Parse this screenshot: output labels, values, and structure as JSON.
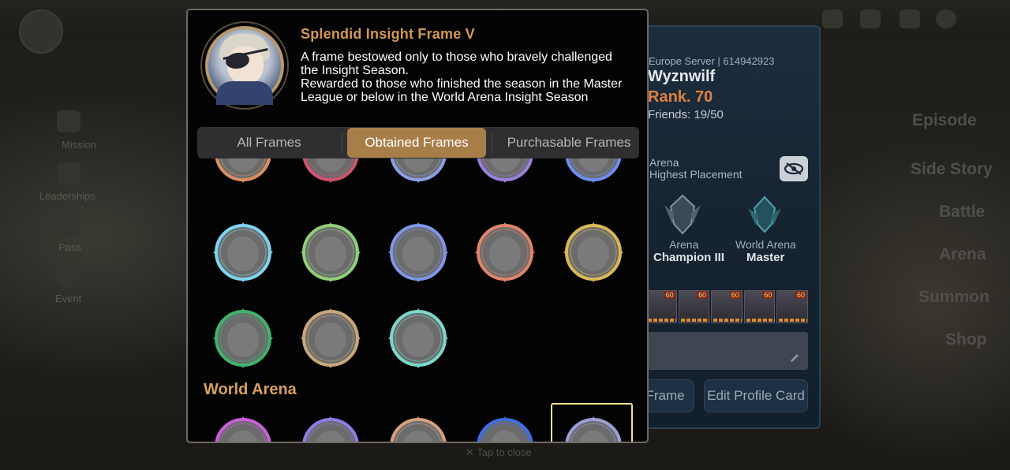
{
  "background": {
    "left_menu": [
      "Mission",
      "Leaderships",
      "Pass",
      "Event"
    ],
    "right_menu": [
      "Episode",
      "Side Story",
      "Battle",
      "Arena",
      "Summon",
      "Shop"
    ],
    "tap_to_close": "Tap to close"
  },
  "profile_card": {
    "server": "Europe Server | 614942923",
    "name": "Wyznwilf",
    "rank": "Rank. 70",
    "friends": "Friends: 19/50",
    "arena_highest_label_1": "Arena",
    "arena_highest_label_2": "Highest Placement",
    "arena": {
      "label": "Arena",
      "value": "Champion III"
    },
    "world_arena": {
      "label": "World Arena",
      "value": "Master"
    },
    "hero_levels": [
      "60",
      "60",
      "60",
      "60",
      "60"
    ],
    "frame_button": "Frame",
    "edit_profile_button": "Edit Profile Card",
    "colors": {
      "rank": "#e0813a"
    }
  },
  "dialog": {
    "frame_title": "Splendid Insight Frame V",
    "description_lines": [
      "A frame bestowed only to those who bravely challenged",
      "the Insight Season.",
      "Rewarded to those who finished the season in the Master",
      "League or below in the World Arena Insight Season"
    ],
    "tabs": [
      {
        "label": "All Frames",
        "active": false
      },
      {
        "label": "Obtained Frames",
        "active": true
      },
      {
        "label": "Purchasable Frames",
        "active": false
      }
    ],
    "section_world_arena": "World Arena",
    "frames_row0_colors": [
      "#d98e63",
      "#cf5370",
      "#8c9ee6",
      "#9b7fe0",
      "#6d8df2"
    ],
    "frames_row1_colors": [
      "#7dd3ef",
      "#8fcf77",
      "#7f96ea",
      "#e0836a",
      "#d9b857"
    ],
    "frames_row2_colors": [
      "#3fb36e",
      "#c9a77a",
      "#79d8c9"
    ],
    "frames_world_arena_colors": [
      "#c85fd8",
      "#8e7be6",
      "#d4a07e",
      "#3d6ee6",
      "#9a9fd6"
    ],
    "colors": {
      "title": "#d49a55",
      "tab_active": "#a87e48",
      "section": "#d8a05e",
      "selection": "#efe08e"
    }
  }
}
